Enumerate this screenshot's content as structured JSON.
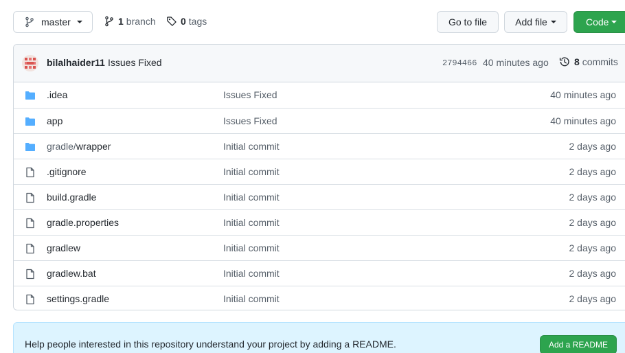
{
  "toolbar": {
    "branch_selector": "master",
    "branch_count": "1",
    "branch_label": "branch",
    "tag_count": "0",
    "tag_label": "tags",
    "go_to_file": "Go to file",
    "add_file": "Add file",
    "code": "Code"
  },
  "latest_commit": {
    "author": "bilalhaider11",
    "message": "Issues Fixed",
    "sha": "2794466",
    "time": "40 minutes ago",
    "commit_count": "8",
    "commits_label": "commits"
  },
  "files": [
    {
      "type": "folder",
      "name": ".idea",
      "name_prefix": "",
      "message": "Issues Fixed",
      "age": "40 minutes ago"
    },
    {
      "type": "folder",
      "name": "app",
      "name_prefix": "",
      "message": "Issues Fixed",
      "age": "40 minutes ago"
    },
    {
      "type": "folder",
      "name": "wrapper",
      "name_prefix": "gradle/",
      "message": "Initial commit",
      "age": "2 days ago"
    },
    {
      "type": "file",
      "name": ".gitignore",
      "name_prefix": "",
      "message": "Initial commit",
      "age": "2 days ago"
    },
    {
      "type": "file",
      "name": "build.gradle",
      "name_prefix": "",
      "message": "Initial commit",
      "age": "2 days ago"
    },
    {
      "type": "file",
      "name": "gradle.properties",
      "name_prefix": "",
      "message": "Initial commit",
      "age": "2 days ago"
    },
    {
      "type": "file",
      "name": "gradlew",
      "name_prefix": "",
      "message": "Initial commit",
      "age": "2 days ago"
    },
    {
      "type": "file",
      "name": "gradlew.bat",
      "name_prefix": "",
      "message": "Initial commit",
      "age": "2 days ago"
    },
    {
      "type": "file",
      "name": "settings.gradle",
      "name_prefix": "",
      "message": "Initial commit",
      "age": "2 days ago"
    }
  ],
  "readme_banner": {
    "text": "Help people interested in this repository understand your project by adding a README.",
    "button": "Add a README"
  },
  "colors": {
    "accent_green": "#2da44e",
    "folder_blue": "#54aeff",
    "banner_bg": "#ddf4ff"
  }
}
